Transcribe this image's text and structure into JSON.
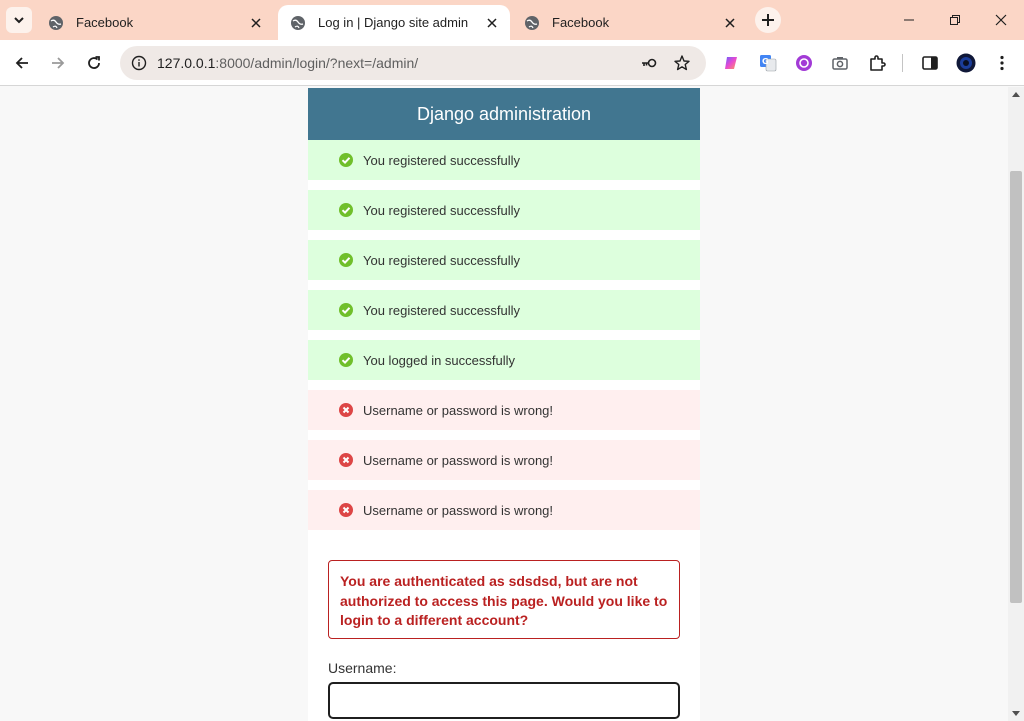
{
  "browser": {
    "tabs": [
      {
        "title": "Facebook",
        "active": false
      },
      {
        "title": "Log in | Django site admin",
        "active": true
      },
      {
        "title": "Facebook",
        "active": false
      }
    ],
    "url": {
      "host": "127.0.0.1",
      "path": ":8000/admin/login/?next=/admin/"
    }
  },
  "page": {
    "site_title": "Django administration",
    "messages": [
      {
        "type": "success",
        "text": "You registered successfully"
      },
      {
        "type": "success",
        "text": "You registered successfully"
      },
      {
        "type": "success",
        "text": "You registered successfully"
      },
      {
        "type": "success",
        "text": "You registered successfully"
      },
      {
        "type": "success",
        "text": "You logged in successfully"
      },
      {
        "type": "error",
        "text": "Username or password is wrong!"
      },
      {
        "type": "error",
        "text": "Username or password is wrong!"
      },
      {
        "type": "error",
        "text": "Username or password is wrong!"
      }
    ],
    "errornote": "You are authenticated as sdsdsd, but are not authorized to access this page. Would you like to login to a different account?",
    "username_label": "Username:",
    "username_value": ""
  },
  "colors": {
    "header_bg": "#417690",
    "success_bg": "#ddffdd",
    "error_bg": "#ffefef",
    "error_text": "#ba2121",
    "tabstrip_bg": "#fbd6c6"
  }
}
